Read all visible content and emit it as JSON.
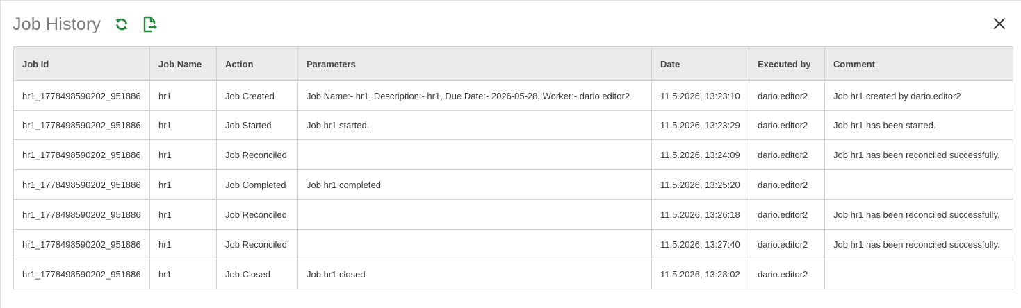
{
  "dialog": {
    "title": "Job History",
    "refresh_icon": "refresh-icon",
    "export_icon": "export-icon",
    "close_icon": "close-icon"
  },
  "colors": {
    "accent_green": "#1e8a3c",
    "header_bg": "#ebebeb",
    "border": "#cfcfcf"
  },
  "table": {
    "columns": [
      "Job Id",
      "Job Name",
      "Action",
      "Parameters",
      "Date",
      "Executed by",
      "Comment"
    ],
    "rows": [
      [
        "hr1_1778498590202_951886",
        "hr1",
        "Job Created",
        "Job Name:- hr1, Description:- hr1, Due Date:- 2026-05-28, Worker:- dario.editor2",
        "11.5.2026, 13:23:10",
        "dario.editor2",
        "Job hr1 created by dario.editor2"
      ],
      [
        "hr1_1778498590202_951886",
        "hr1",
        "Job Started",
        "Job hr1 started.",
        "11.5.2026, 13:23:29",
        "dario.editor2",
        "Job hr1 has been started."
      ],
      [
        "hr1_1778498590202_951886",
        "hr1",
        "Job Reconciled",
        "",
        "11.5.2026, 13:24:09",
        "dario.editor2",
        "Job hr1 has been reconciled successfully."
      ],
      [
        "hr1_1778498590202_951886",
        "hr1",
        "Job Completed",
        "Job hr1 completed",
        "11.5.2026, 13:25:20",
        "dario.editor2",
        ""
      ],
      [
        "hr1_1778498590202_951886",
        "hr1",
        "Job Reconciled",
        "",
        "11.5.2026, 13:26:18",
        "dario.editor2",
        "Job hr1 has been reconciled successfully."
      ],
      [
        "hr1_1778498590202_951886",
        "hr1",
        "Job Reconciled",
        "",
        "11.5.2026, 13:27:40",
        "dario.editor2",
        "Job hr1 has been reconciled successfully."
      ],
      [
        "hr1_1778498590202_951886",
        "hr1",
        "Job Closed",
        "Job hr1 closed",
        "11.5.2026, 13:28:02",
        "dario.editor2",
        ""
      ]
    ]
  }
}
